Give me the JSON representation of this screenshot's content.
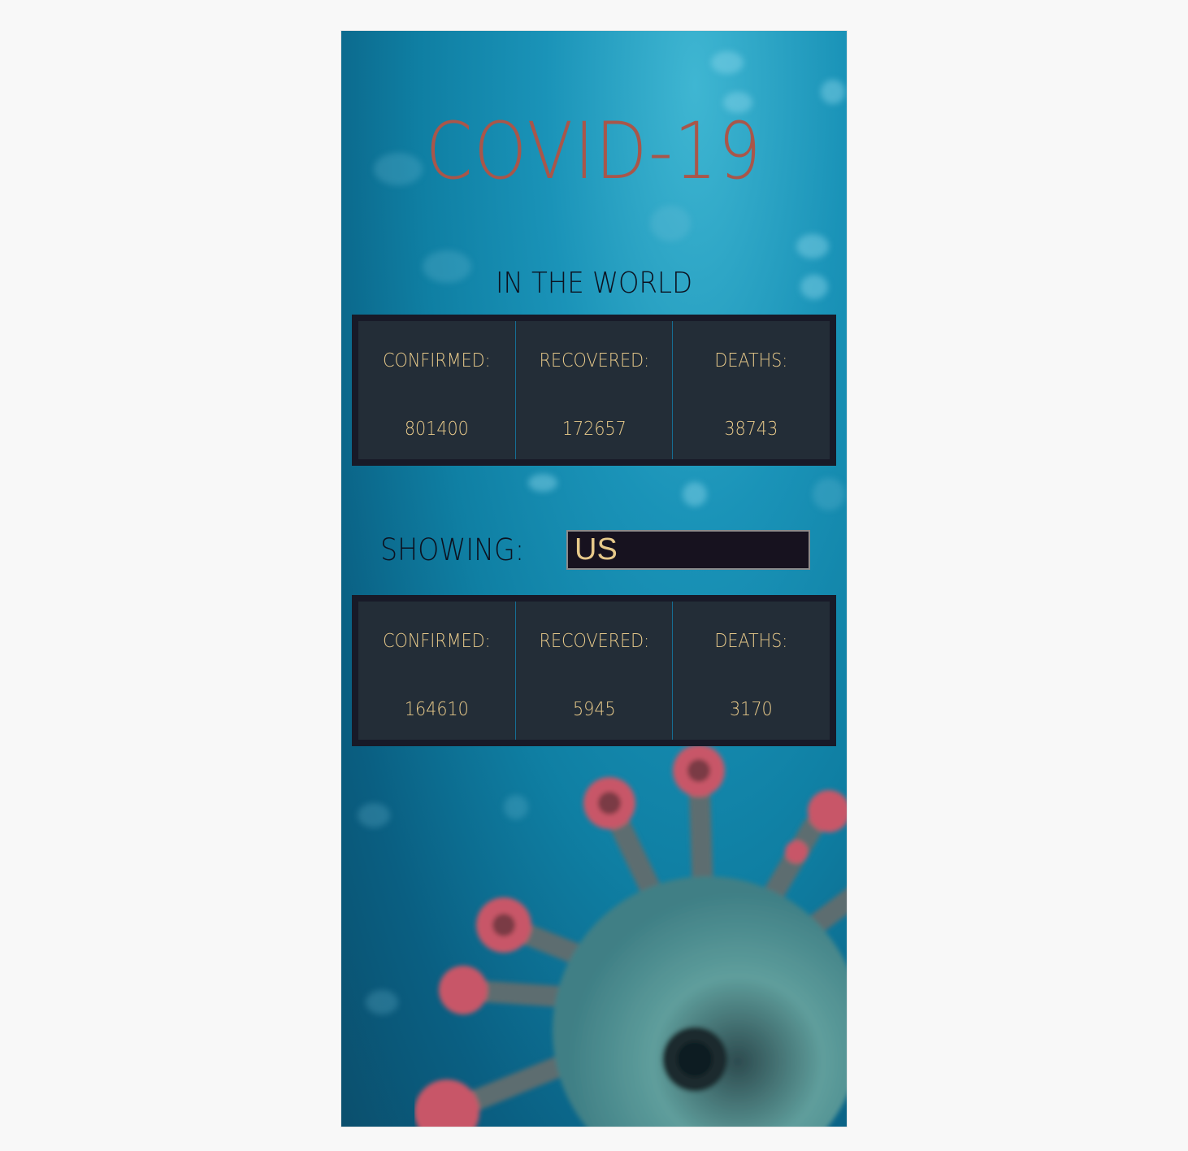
{
  "app": {
    "title": "COVID-19"
  },
  "world": {
    "heading": "IN THE WORLD",
    "confirmed_label": "CONFIRMED:",
    "recovered_label": "RECOVERED:",
    "deaths_label": "DEATHS:",
    "confirmed": "801400",
    "recovered": "172657",
    "deaths": "38743"
  },
  "country": {
    "showing_label": "SHOWING:",
    "selected": "US",
    "confirmed_label": "CONFIRMED:",
    "recovered_label": "RECOVERED:",
    "deaths_label": "DEATHS:",
    "confirmed": "164610",
    "recovered": "5945",
    "deaths": "3170"
  },
  "colors": {
    "title": "#a9564a",
    "stat_text": "#e7c98a",
    "panel_bg": "#232d37",
    "panel_border": "#181a28",
    "background": "#1a93b8"
  },
  "decor": {
    "background_image": "blurred-virus-illustration"
  }
}
